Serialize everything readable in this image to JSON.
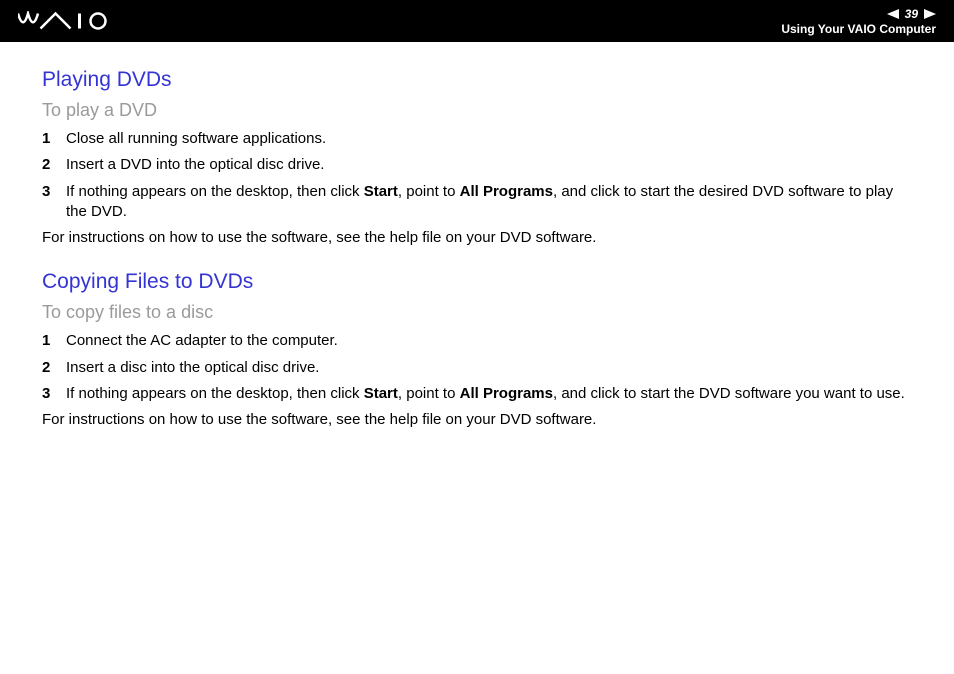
{
  "header": {
    "page_number": "39",
    "subtitle": "Using Your VAIO Computer"
  },
  "section1": {
    "heading": "Playing DVDs",
    "sub": "To play a DVD",
    "items": [
      {
        "n": "1",
        "pre": "Close all running software applications."
      },
      {
        "n": "2",
        "pre": "Insert a DVD into the optical disc drive."
      },
      {
        "n": "3",
        "pre": "If nothing appears on the desktop, then click ",
        "b1": "Start",
        "mid": ", point to ",
        "b2": "All Programs",
        "post": ", and click to start the desired DVD software to play the DVD."
      }
    ],
    "para": "For instructions on how to use the software, see the help file on your DVD software."
  },
  "section2": {
    "heading": "Copying Files to DVDs",
    "sub": "To copy files to a disc",
    "items": [
      {
        "n": "1",
        "pre": "Connect the AC adapter to the computer."
      },
      {
        "n": "2",
        "pre": "Insert a disc into the optical disc drive."
      },
      {
        "n": "3",
        "pre": "If nothing appears on the desktop, then click ",
        "b1": "Start",
        "mid": ", point to ",
        "b2": "All Programs",
        "post": ", and click to start the DVD software you want to use."
      }
    ],
    "para": "For instructions on how to use the software, see the help file on your DVD software."
  }
}
